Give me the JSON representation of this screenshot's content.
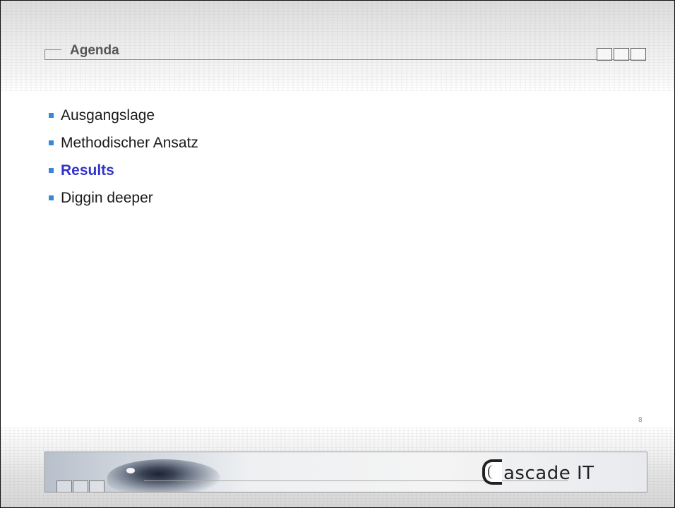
{
  "header": {
    "title": "Agenda"
  },
  "agenda": {
    "items": [
      {
        "label": "Ausgangslage",
        "active": false
      },
      {
        "label": "Methodischer Ansatz",
        "active": false
      },
      {
        "label": "Results",
        "active": true
      },
      {
        "label": "Diggin deeper",
        "active": false
      }
    ]
  },
  "footer": {
    "page_number": "8",
    "logo_text": "ascade IT"
  },
  "colors": {
    "bullet": "#3a86d8",
    "active_text": "#3333cc",
    "title": "#555555"
  }
}
